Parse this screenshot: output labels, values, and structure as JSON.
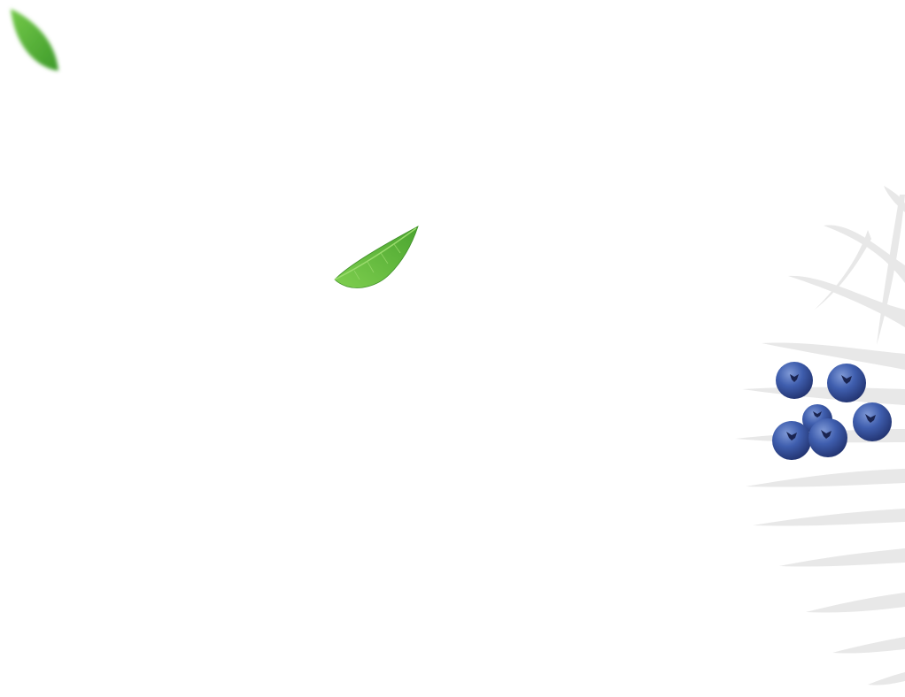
{
  "scene": {
    "background_color": "#ffffff",
    "elements": [
      {
        "name": "blurred-leaf",
        "icon": "leaf-icon",
        "color": "#5cb83a"
      },
      {
        "name": "falling-leaf",
        "icon": "leaf-icon",
        "color": "#6bbf3e"
      },
      {
        "name": "palm-frond-decoration",
        "icon": "palm-frond-icon",
        "color": "#e6e6e6"
      },
      {
        "name": "blueberry-cluster",
        "icon": "blueberry-icon",
        "count": 6,
        "color": "#3d5aa8"
      }
    ]
  }
}
